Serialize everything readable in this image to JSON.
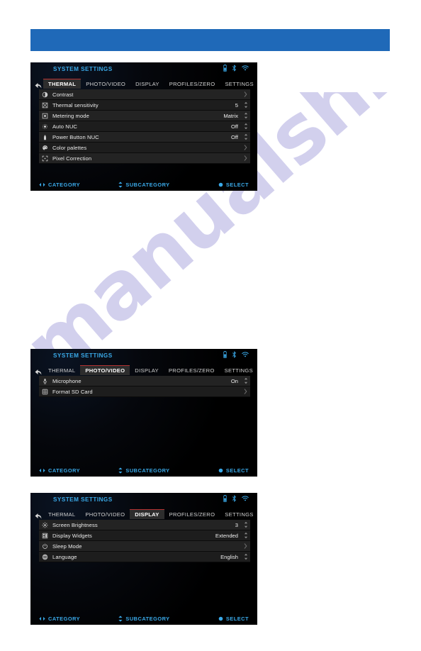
{
  "page": {
    "watermark": "manualshive.com",
    "banner_color": "#1f69b8",
    "accent_blue": "#3aa9e8",
    "active_tab_underline": "#b33232"
  },
  "screens": [
    {
      "title": "SYSTEM SETTINGS",
      "status_icons": [
        "battery-icon",
        "bluetooth-icon",
        "wifi-icon"
      ],
      "back_icon": "back-arrow-icon",
      "tabs": [
        {
          "label": "THERMAL",
          "active": true
        },
        {
          "label": "PHOTO/VIDEO",
          "active": false
        },
        {
          "label": "DISPLAY",
          "active": false
        },
        {
          "label": "PROFILES/ZERO",
          "active": false
        },
        {
          "label": "SETTINGS",
          "active": false
        }
      ],
      "rows": [
        {
          "icon": "contrast-icon",
          "label": "Contrast",
          "value": "",
          "control": "chevron-right"
        },
        {
          "icon": "sensitivity-icon",
          "label": "Thermal sensitivity",
          "value": "5",
          "control": "stepper"
        },
        {
          "icon": "metering-icon",
          "label": "Metering mode",
          "value": "Matrix",
          "control": "stepper"
        },
        {
          "icon": "auto-nuc-icon",
          "label": "Auto NUC",
          "value": "Off",
          "control": "stepper"
        },
        {
          "icon": "power-button-icon",
          "label": "Power Button NUC",
          "value": "Off",
          "control": "stepper"
        },
        {
          "icon": "palette-icon",
          "label": "Color palettes",
          "value": "",
          "control": "chevron-right"
        },
        {
          "icon": "pixel-correction-icon",
          "label": "Pixel Correction",
          "value": "",
          "control": "chevron-right"
        }
      ],
      "footer": [
        {
          "icon": "left-right-arrows-icon",
          "label": "CATEGORY"
        },
        {
          "icon": "up-down-arrows-icon",
          "label": "SUBCATEGORY"
        },
        {
          "icon": "dot-icon",
          "label": "SELECT"
        }
      ]
    },
    {
      "title": "SYSTEM SETTINGS",
      "status_icons": [
        "battery-icon",
        "bluetooth-icon",
        "wifi-icon"
      ],
      "back_icon": "back-arrow-icon",
      "tabs": [
        {
          "label": "THERMAL",
          "active": false
        },
        {
          "label": "PHOTO/VIDEO",
          "active": true
        },
        {
          "label": "DISPLAY",
          "active": false
        },
        {
          "label": "PROFILES/ZERO",
          "active": false
        },
        {
          "label": "SETTINGS",
          "active": false
        }
      ],
      "rows": [
        {
          "icon": "microphone-icon",
          "label": "Microphone",
          "value": "On",
          "control": "stepper"
        },
        {
          "icon": "sd-card-icon",
          "label": "Format SD Card",
          "value": "",
          "control": "chevron-right"
        }
      ],
      "footer": [
        {
          "icon": "left-right-arrows-icon",
          "label": "CATEGORY"
        },
        {
          "icon": "up-down-arrows-icon",
          "label": "SUBCATEGORY"
        },
        {
          "icon": "dot-icon",
          "label": "SELECT"
        }
      ]
    },
    {
      "title": "SYSTEM SETTINGS",
      "status_icons": [
        "battery-icon",
        "bluetooth-icon",
        "wifi-icon"
      ],
      "back_icon": "back-arrow-icon",
      "tabs": [
        {
          "label": "THERMAL",
          "active": false
        },
        {
          "label": "PHOTO/VIDEO",
          "active": false
        },
        {
          "label": "DISPLAY",
          "active": true
        },
        {
          "label": "PROFILES/ZERO",
          "active": false
        },
        {
          "label": "SETTINGS",
          "active": false
        }
      ],
      "rows": [
        {
          "icon": "brightness-icon",
          "label": "Screen Brightness",
          "value": "3",
          "control": "stepper"
        },
        {
          "icon": "widgets-icon",
          "label": "Display Widgets",
          "value": "Extended",
          "control": "stepper"
        },
        {
          "icon": "sleep-mode-icon",
          "label": "Sleep Mode",
          "value": "",
          "control": "chevron-right"
        },
        {
          "icon": "globe-icon",
          "label": "Language",
          "value": "English",
          "control": "stepper"
        }
      ],
      "footer": [
        {
          "icon": "left-right-arrows-icon",
          "label": "CATEGORY"
        },
        {
          "icon": "up-down-arrows-icon",
          "label": "SUBCATEGORY"
        },
        {
          "icon": "dot-icon",
          "label": "SELECT"
        }
      ]
    }
  ]
}
